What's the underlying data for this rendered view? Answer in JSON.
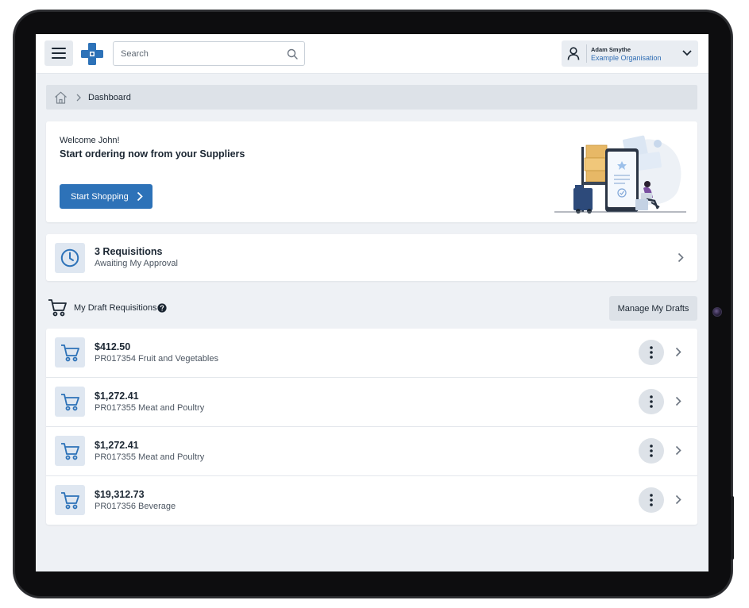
{
  "header": {
    "search_placeholder": "Search",
    "user": {
      "name": "Adam Smythe",
      "organisation": "Example Organisation"
    }
  },
  "breadcrumb": {
    "current": "Dashboard"
  },
  "welcome": {
    "greeting": "Welcome John!",
    "headline": "Start ordering now from your Suppliers",
    "cta_label": "Start Shopping"
  },
  "requisitions": {
    "title": "3 Requisitions",
    "subtitle": "Awaiting My Approval"
  },
  "drafts": {
    "heading": "My Draft Requisitions",
    "manage_label": "Manage My Drafts",
    "items": [
      {
        "amount": "$412.50",
        "description": "PR017354 Fruit and Vegetables"
      },
      {
        "amount": "$1,272.41",
        "description": "PR017355 Meat and Poultry"
      },
      {
        "amount": "$1,272.41",
        "description": "PR017355 Meat and Poultry"
      },
      {
        "amount": "$19,312.73",
        "description": "PR017356 Beverage"
      }
    ]
  },
  "colors": {
    "accent": "#2d72b8",
    "background": "#eef1f5",
    "icon_tile": "#dfe7f1"
  }
}
